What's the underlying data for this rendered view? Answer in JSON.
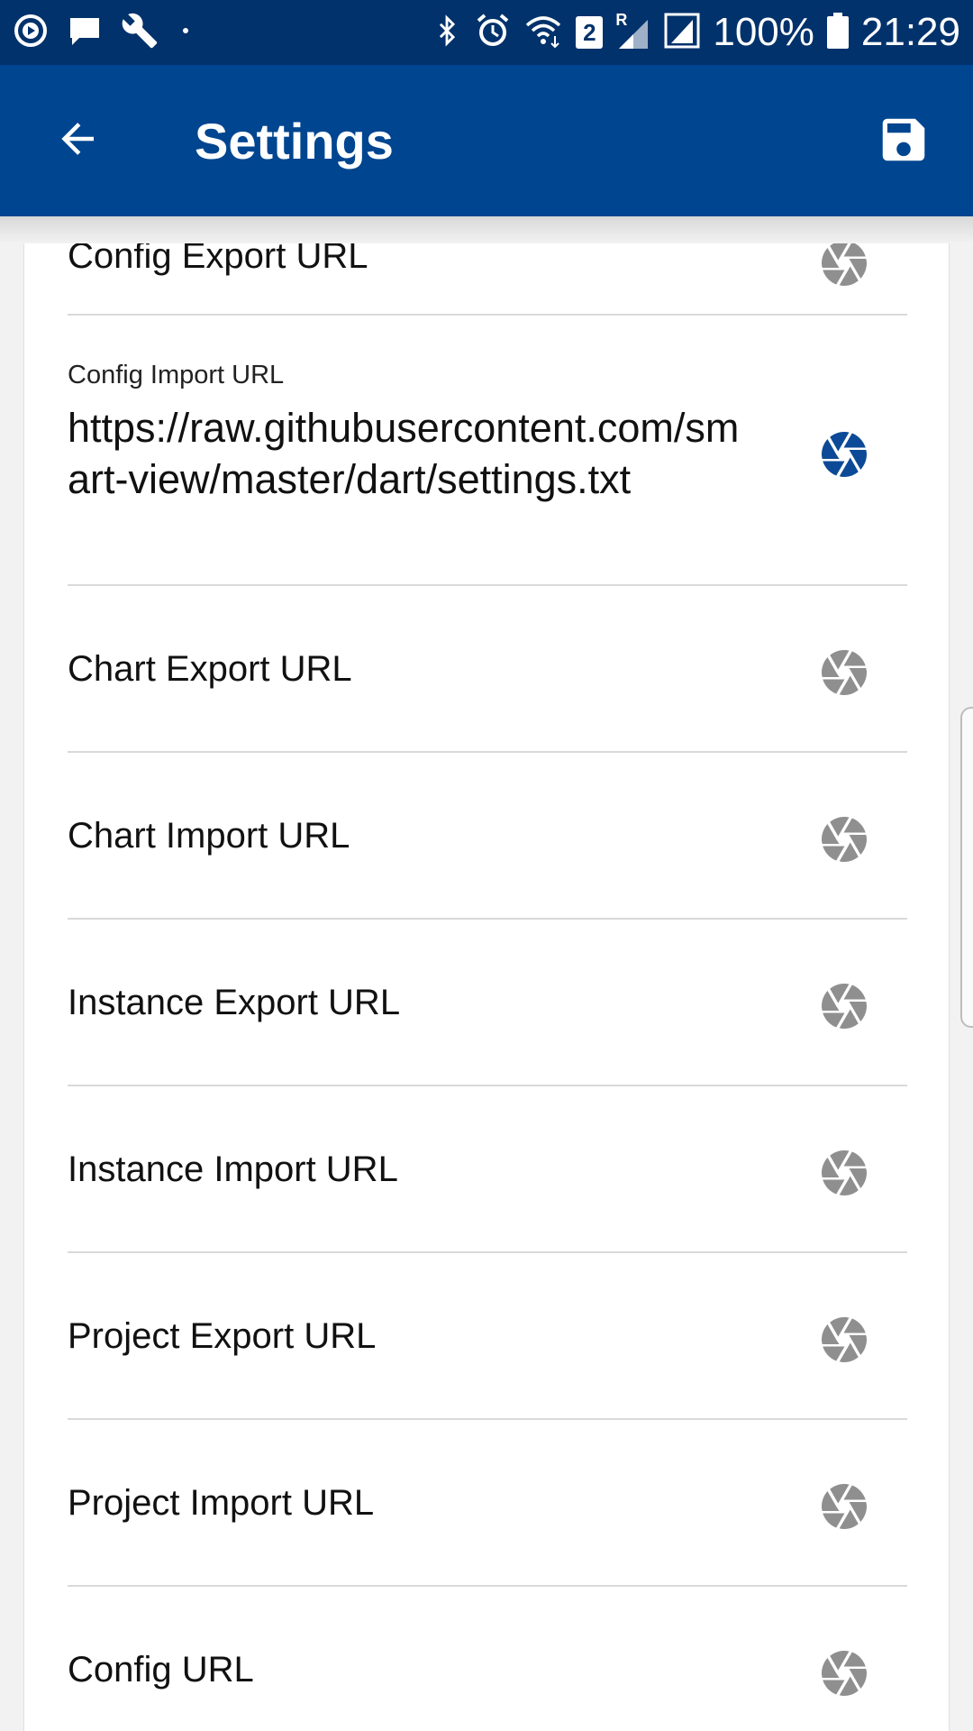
{
  "status_bar": {
    "battery": "100%",
    "time": "21:29",
    "sim_slot": "2",
    "roaming": "R"
  },
  "app_bar": {
    "title": "Settings"
  },
  "rows": [
    {
      "label": "Config Export URL",
      "icon_state": "inactive"
    },
    {
      "label": "Config Import URL",
      "value": "https://raw.githubusercontent.com/smart-view/master/dart/settings.txt",
      "icon_state": "active"
    },
    {
      "label": "Chart Export URL",
      "icon_state": "inactive"
    },
    {
      "label": "Chart Import URL",
      "icon_state": "inactive"
    },
    {
      "label": "Instance Export URL",
      "icon_state": "inactive"
    },
    {
      "label": "Instance Import URL",
      "icon_state": "inactive"
    },
    {
      "label": "Project Export URL",
      "icon_state": "inactive"
    },
    {
      "label": "Project Import URL",
      "icon_state": "inactive"
    },
    {
      "label": "Config URL",
      "icon_state": "inactive"
    }
  ],
  "colors": {
    "status_bar": "#02326b",
    "app_bar": "#004590",
    "icon_active": "#0c4a97",
    "icon_inactive": "#8f8f8f"
  },
  "icons": {
    "back": "arrow-back-icon",
    "save": "save-icon",
    "row": "aperture-icon"
  }
}
